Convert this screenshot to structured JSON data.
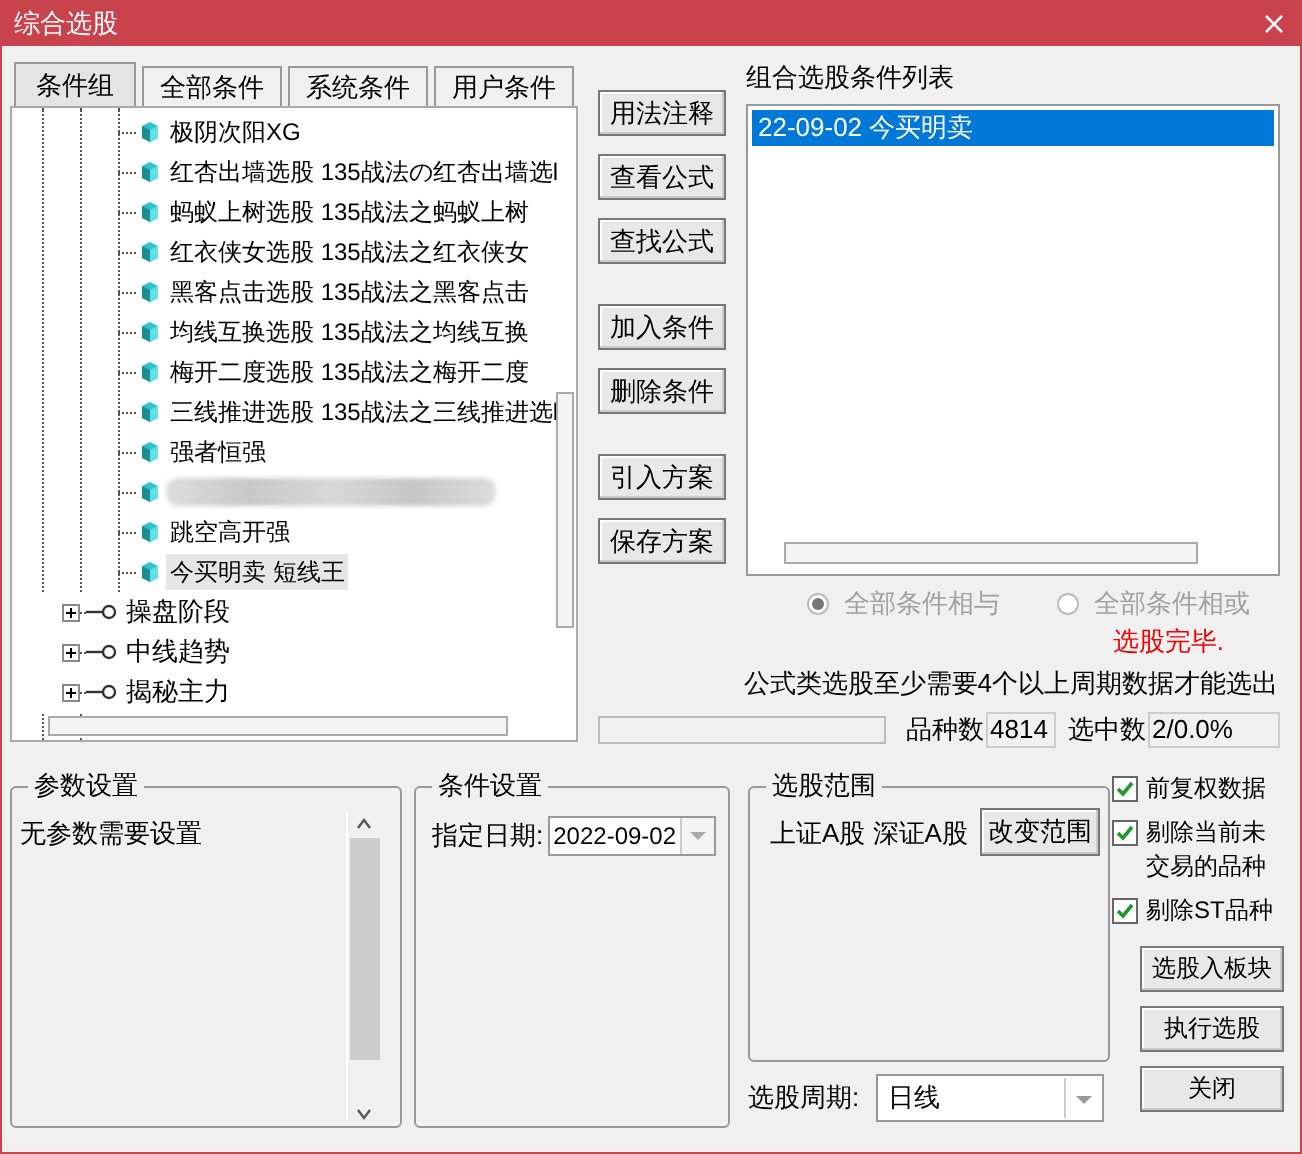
{
  "window": {
    "title": "综合选股"
  },
  "tabs": [
    {
      "label": "条件组",
      "selected": true
    },
    {
      "label": "全部条件",
      "selected": false
    },
    {
      "label": "系统条件",
      "selected": false
    },
    {
      "label": "用户条件",
      "selected": false
    }
  ],
  "tree": [
    {
      "kind": "leaf",
      "label": "极阴次阳XG",
      "selected": false
    },
    {
      "kind": "leaf",
      "label": "红杏出墙选股 135战法の红杏出墙选l",
      "selected": false
    },
    {
      "kind": "leaf",
      "label": "蚂蚁上树选股 135战法之蚂蚁上树",
      "selected": false
    },
    {
      "kind": "leaf",
      "label": "红衣侠女选股 135战法之红衣侠女",
      "selected": false
    },
    {
      "kind": "leaf",
      "label": "黑客点击选股 135战法之黑客点击",
      "selected": false
    },
    {
      "kind": "leaf",
      "label": "均线互换选股 135战法之均线互换",
      "selected": false
    },
    {
      "kind": "leaf",
      "label": "梅开二度选股 135战法之梅开二度",
      "selected": false
    },
    {
      "kind": "leaf",
      "label": "三线推进选股 135战法之三线推进选l",
      "selected": false
    },
    {
      "kind": "leaf",
      "label": "强者恒强",
      "selected": false
    },
    {
      "kind": "blurred"
    },
    {
      "kind": "leaf",
      "label": "跳空高开强",
      "selected": false
    },
    {
      "kind": "leaf",
      "label": "今买明卖 短线王",
      "selected": true
    },
    {
      "kind": "group",
      "label": "操盘阶段",
      "expanded": false
    },
    {
      "kind": "group",
      "label": "中线趋势",
      "expanded": false
    },
    {
      "kind": "group",
      "label": "揭秘主力",
      "expanded": false
    }
  ],
  "button_groups": [
    [
      "用法注释",
      "查看公式",
      "查找公式"
    ],
    [
      "加入条件",
      "删除条件"
    ],
    [
      "引入方案",
      "保存方案"
    ]
  ],
  "condition_list": {
    "title": "组合选股条件列表",
    "items": [
      {
        "label": "22-09-02 今买明卖",
        "selected": true
      }
    ]
  },
  "logic_options": [
    {
      "label": "全部条件相与",
      "selected": true,
      "disabled": true
    },
    {
      "label": "全部条件相或",
      "selected": false,
      "disabled": true
    }
  ],
  "status_message": "选股完毕.",
  "note": "公式类选股至少需要4个以上周期数据才能选出",
  "progress": {
    "level": 0
  },
  "stats": [
    {
      "label": "品种数",
      "value": "4814"
    },
    {
      "label": "选中数",
      "value": "2/0.0%"
    }
  ],
  "params": {
    "title": "参数设置",
    "text": "无参数需要设置"
  },
  "condition_settings": {
    "title": "条件设置",
    "date_label": "指定日期:",
    "date_value": "2022-09-02"
  },
  "range": {
    "title": "选股范围",
    "text": "上证A股 深证A股",
    "button": "改变范围"
  },
  "period": {
    "label": "选股周期:",
    "value": "日线"
  },
  "options": [
    {
      "label": "前复权数据",
      "checked": true
    },
    {
      "label": "剔除当前未交易的品种",
      "checked": true
    },
    {
      "label": "剔除ST品种",
      "checked": true
    }
  ],
  "buttons": [
    "选股入板块",
    "执行选股",
    "关闭"
  ]
}
